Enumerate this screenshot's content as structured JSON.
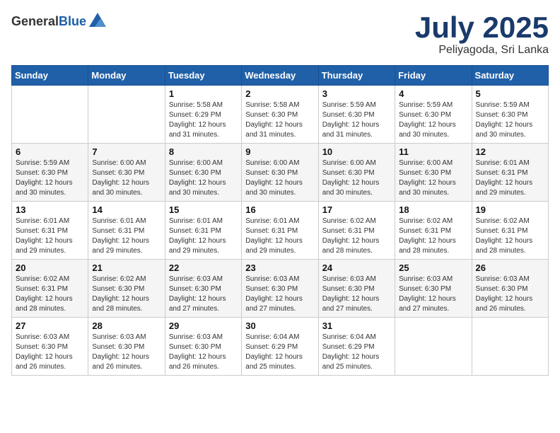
{
  "header": {
    "logo_general": "General",
    "logo_blue": "Blue",
    "month_year": "July 2025",
    "location": "Peliyagoda, Sri Lanka"
  },
  "weekdays": [
    "Sunday",
    "Monday",
    "Tuesday",
    "Wednesday",
    "Thursday",
    "Friday",
    "Saturday"
  ],
  "weeks": [
    [
      {
        "day": "",
        "info": ""
      },
      {
        "day": "",
        "info": ""
      },
      {
        "day": "1",
        "info": "Sunrise: 5:58 AM\nSunset: 6:29 PM\nDaylight: 12 hours and 31 minutes."
      },
      {
        "day": "2",
        "info": "Sunrise: 5:58 AM\nSunset: 6:30 PM\nDaylight: 12 hours and 31 minutes."
      },
      {
        "day": "3",
        "info": "Sunrise: 5:59 AM\nSunset: 6:30 PM\nDaylight: 12 hours and 31 minutes."
      },
      {
        "day": "4",
        "info": "Sunrise: 5:59 AM\nSunset: 6:30 PM\nDaylight: 12 hours and 30 minutes."
      },
      {
        "day": "5",
        "info": "Sunrise: 5:59 AM\nSunset: 6:30 PM\nDaylight: 12 hours and 30 minutes."
      }
    ],
    [
      {
        "day": "6",
        "info": "Sunrise: 5:59 AM\nSunset: 6:30 PM\nDaylight: 12 hours and 30 minutes."
      },
      {
        "day": "7",
        "info": "Sunrise: 6:00 AM\nSunset: 6:30 PM\nDaylight: 12 hours and 30 minutes."
      },
      {
        "day": "8",
        "info": "Sunrise: 6:00 AM\nSunset: 6:30 PM\nDaylight: 12 hours and 30 minutes."
      },
      {
        "day": "9",
        "info": "Sunrise: 6:00 AM\nSunset: 6:30 PM\nDaylight: 12 hours and 30 minutes."
      },
      {
        "day": "10",
        "info": "Sunrise: 6:00 AM\nSunset: 6:30 PM\nDaylight: 12 hours and 30 minutes."
      },
      {
        "day": "11",
        "info": "Sunrise: 6:00 AM\nSunset: 6:30 PM\nDaylight: 12 hours and 30 minutes."
      },
      {
        "day": "12",
        "info": "Sunrise: 6:01 AM\nSunset: 6:31 PM\nDaylight: 12 hours and 29 minutes."
      }
    ],
    [
      {
        "day": "13",
        "info": "Sunrise: 6:01 AM\nSunset: 6:31 PM\nDaylight: 12 hours and 29 minutes."
      },
      {
        "day": "14",
        "info": "Sunrise: 6:01 AM\nSunset: 6:31 PM\nDaylight: 12 hours and 29 minutes."
      },
      {
        "day": "15",
        "info": "Sunrise: 6:01 AM\nSunset: 6:31 PM\nDaylight: 12 hours and 29 minutes."
      },
      {
        "day": "16",
        "info": "Sunrise: 6:01 AM\nSunset: 6:31 PM\nDaylight: 12 hours and 29 minutes."
      },
      {
        "day": "17",
        "info": "Sunrise: 6:02 AM\nSunset: 6:31 PM\nDaylight: 12 hours and 28 minutes."
      },
      {
        "day": "18",
        "info": "Sunrise: 6:02 AM\nSunset: 6:31 PM\nDaylight: 12 hours and 28 minutes."
      },
      {
        "day": "19",
        "info": "Sunrise: 6:02 AM\nSunset: 6:31 PM\nDaylight: 12 hours and 28 minutes."
      }
    ],
    [
      {
        "day": "20",
        "info": "Sunrise: 6:02 AM\nSunset: 6:31 PM\nDaylight: 12 hours and 28 minutes."
      },
      {
        "day": "21",
        "info": "Sunrise: 6:02 AM\nSunset: 6:30 PM\nDaylight: 12 hours and 28 minutes."
      },
      {
        "day": "22",
        "info": "Sunrise: 6:03 AM\nSunset: 6:30 PM\nDaylight: 12 hours and 27 minutes."
      },
      {
        "day": "23",
        "info": "Sunrise: 6:03 AM\nSunset: 6:30 PM\nDaylight: 12 hours and 27 minutes."
      },
      {
        "day": "24",
        "info": "Sunrise: 6:03 AM\nSunset: 6:30 PM\nDaylight: 12 hours and 27 minutes."
      },
      {
        "day": "25",
        "info": "Sunrise: 6:03 AM\nSunset: 6:30 PM\nDaylight: 12 hours and 27 minutes."
      },
      {
        "day": "26",
        "info": "Sunrise: 6:03 AM\nSunset: 6:30 PM\nDaylight: 12 hours and 26 minutes."
      }
    ],
    [
      {
        "day": "27",
        "info": "Sunrise: 6:03 AM\nSunset: 6:30 PM\nDaylight: 12 hours and 26 minutes."
      },
      {
        "day": "28",
        "info": "Sunrise: 6:03 AM\nSunset: 6:30 PM\nDaylight: 12 hours and 26 minutes."
      },
      {
        "day": "29",
        "info": "Sunrise: 6:03 AM\nSunset: 6:30 PM\nDaylight: 12 hours and 26 minutes."
      },
      {
        "day": "30",
        "info": "Sunrise: 6:04 AM\nSunset: 6:29 PM\nDaylight: 12 hours and 25 minutes."
      },
      {
        "day": "31",
        "info": "Sunrise: 6:04 AM\nSunset: 6:29 PM\nDaylight: 12 hours and 25 minutes."
      },
      {
        "day": "",
        "info": ""
      },
      {
        "day": "",
        "info": ""
      }
    ]
  ]
}
